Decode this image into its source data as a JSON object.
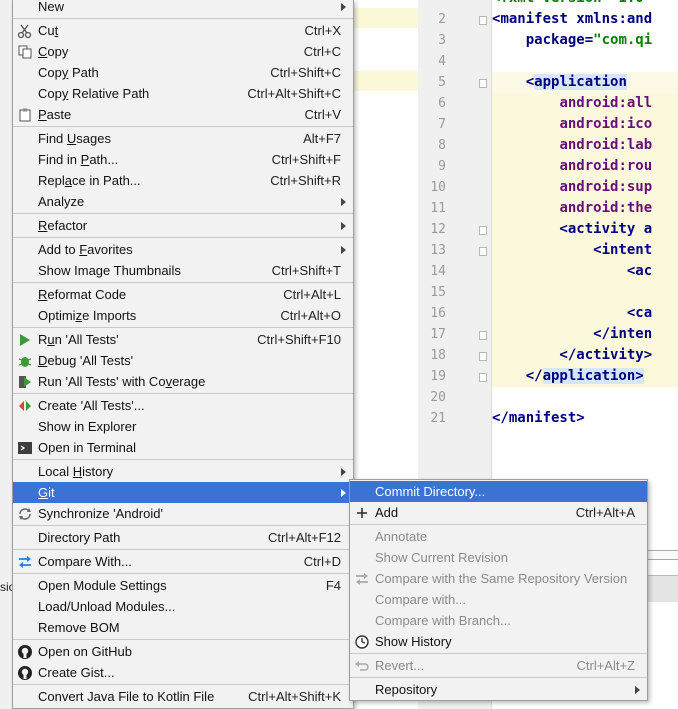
{
  "editor": {
    "line_numbers": [
      "2",
      "3",
      "4",
      "5",
      "6",
      "7",
      "8",
      "9",
      "10",
      "11",
      "12",
      "13",
      "14",
      "15",
      "16",
      "17",
      "18",
      "19",
      "20",
      "21"
    ],
    "code_lines": [
      {
        "a": "<",
        "b": "manifest xmlns:and",
        "c": ""
      },
      {
        "a": "    package=",
        "b": "",
        "c": "\"com.qi"
      },
      {
        "a": "",
        "b": "",
        "c": ""
      },
      {
        "a": "    <",
        "b": "application",
        "c": ""
      },
      {
        "a": "        ",
        "b": "android:all",
        "c": ""
      },
      {
        "a": "        ",
        "b": "android:ico",
        "c": ""
      },
      {
        "a": "        ",
        "b": "android:lab",
        "c": ""
      },
      {
        "a": "        ",
        "b": "android:rou",
        "c": ""
      },
      {
        "a": "        ",
        "b": "android:sup",
        "c": ""
      },
      {
        "a": "        ",
        "b": "android:the",
        "c": ""
      },
      {
        "a": "        <",
        "b": "activity a",
        "c": ""
      },
      {
        "a": "            <",
        "b": "intent",
        "c": ""
      },
      {
        "a": "                <",
        "b": "ac",
        "c": ""
      },
      {
        "a": "",
        "b": "",
        "c": ""
      },
      {
        "a": "                <",
        "b": "ca",
        "c": ""
      },
      {
        "a": "            </",
        "b": "inten",
        "c": ""
      },
      {
        "a": "        </",
        "b": "activity>",
        "c": ""
      },
      {
        "a": "    </",
        "b": "application>",
        "c": ""
      },
      {
        "a": "",
        "b": "",
        "c": ""
      },
      {
        "a": "</",
        "b": "manifest>",
        "c": ""
      }
    ],
    "partial_top": "<?xml version=\"1.0\"",
    "left_fragment": "sic"
  },
  "context_menu": {
    "items": [
      {
        "label": "New",
        "mn": "",
        "shortcut": "",
        "submenu": true,
        "icon": ""
      },
      {
        "label": "Cut",
        "mn": "t",
        "shortcut": "Ctrl+X",
        "icon": "scissors-icon"
      },
      {
        "label": "Copy",
        "mn": "C",
        "shortcut": "Ctrl+C",
        "icon": "copy-icon"
      },
      {
        "label": "Copy Path",
        "mn": "y",
        "shortcut": "Ctrl+Shift+C",
        "icon": ""
      },
      {
        "label": "Copy Relative Path",
        "mn": "y",
        "shortcut": "Ctrl+Alt+Shift+C",
        "icon": ""
      },
      {
        "label": "Paste",
        "mn": "P",
        "shortcut": "Ctrl+V",
        "icon": "paste-icon"
      },
      {
        "label": "Find Usages",
        "mn": "U",
        "shortcut": "Alt+F7",
        "icon": ""
      },
      {
        "label": "Find in Path...",
        "mn": "P",
        "shortcut": "Ctrl+Shift+F",
        "icon": ""
      },
      {
        "label": "Replace in Path...",
        "mn": "a",
        "shortcut": "Ctrl+Shift+R",
        "icon": ""
      },
      {
        "label": "Analyze",
        "mn": "",
        "shortcut": "",
        "submenu": true,
        "icon": ""
      },
      {
        "label": "Refactor",
        "mn": "R",
        "shortcut": "",
        "submenu": true,
        "icon": ""
      },
      {
        "label": "Add to Favorites",
        "mn": "F",
        "shortcut": "",
        "submenu": true,
        "icon": ""
      },
      {
        "label": "Show Image Thumbnails",
        "mn": "",
        "shortcut": "Ctrl+Shift+T",
        "icon": ""
      },
      {
        "label": "Reformat Code",
        "mn": "R",
        "shortcut": "Ctrl+Alt+L",
        "icon": ""
      },
      {
        "label": "Optimize Imports",
        "mn": "z",
        "shortcut": "Ctrl+Alt+O",
        "icon": ""
      },
      {
        "label": "Run 'All Tests'",
        "mn": "u",
        "shortcut": "Ctrl+Shift+F10",
        "icon": "run-icon"
      },
      {
        "label": "Debug 'All Tests'",
        "mn": "D",
        "shortcut": "",
        "icon": "debug-icon"
      },
      {
        "label": "Run 'All Tests' with Coverage",
        "mn": "v",
        "shortcut": "",
        "icon": "coverage-icon"
      },
      {
        "label": "Create 'All Tests'...",
        "mn": "",
        "shortcut": "",
        "icon": "create-config-icon"
      },
      {
        "label": "Show in Explorer",
        "mn": "",
        "shortcut": "",
        "icon": ""
      },
      {
        "label": "Open in Terminal",
        "mn": "",
        "shortcut": "",
        "icon": "terminal-icon"
      },
      {
        "label": "Local History",
        "mn": "H",
        "shortcut": "",
        "submenu": true,
        "icon": ""
      },
      {
        "label": "Git",
        "mn": "G",
        "shortcut": "",
        "submenu": true,
        "icon": "",
        "selected": true
      },
      {
        "label": "Synchronize 'Android'",
        "mn": "",
        "shortcut": "",
        "icon": "sync-icon"
      },
      {
        "label": "Directory Path",
        "mn": "",
        "shortcut": "Ctrl+Alt+F12",
        "icon": ""
      },
      {
        "label": "Compare With...",
        "mn": "",
        "shortcut": "Ctrl+D",
        "icon": "compare-icon"
      },
      {
        "label": "Open Module Settings",
        "mn": "",
        "shortcut": "F4",
        "icon": ""
      },
      {
        "label": "Load/Unload Modules...",
        "mn": "",
        "shortcut": "",
        "icon": ""
      },
      {
        "label": "Remove BOM",
        "mn": "",
        "shortcut": "",
        "icon": ""
      },
      {
        "label": "Open on GitHub",
        "mn": "",
        "shortcut": "",
        "icon": "github-icon"
      },
      {
        "label": "Create Gist...",
        "mn": "",
        "shortcut": "",
        "icon": "github-icon"
      },
      {
        "label": "Convert Java File to Kotlin File",
        "mn": "",
        "shortcut": "Ctrl+Alt+Shift+K",
        "icon": ""
      }
    ]
  },
  "git_submenu": {
    "items": [
      {
        "label": "Commit Directory...",
        "shortcut": "",
        "selected": true,
        "icon": ""
      },
      {
        "label": "Add",
        "shortcut": "Ctrl+Alt+A",
        "icon": "plus-icon"
      },
      {
        "label": "Annotate",
        "shortcut": "",
        "disabled": true,
        "icon": ""
      },
      {
        "label": "Show Current Revision",
        "shortcut": "",
        "disabled": true,
        "icon": ""
      },
      {
        "label": "Compare with the Same Repository Version",
        "shortcut": "",
        "disabled": true,
        "icon": "compare-icon"
      },
      {
        "label": "Compare with...",
        "shortcut": "",
        "disabled": true,
        "icon": ""
      },
      {
        "label": "Compare with Branch...",
        "shortcut": "",
        "disabled": true,
        "icon": ""
      },
      {
        "label": "Show History",
        "shortcut": "",
        "icon": "history-icon"
      },
      {
        "label": "Revert...",
        "shortcut": "Ctrl+Alt+Z",
        "disabled": true,
        "icon": "revert-icon"
      },
      {
        "label": "Repository",
        "shortcut": "",
        "submenu": true,
        "icon": ""
      }
    ]
  },
  "colors": {
    "selection": "#3b73d4",
    "menu_bg": "#f2f2f2",
    "code_tag": "#000080",
    "code_attr": "#660e7a",
    "code_string": "#008000"
  }
}
